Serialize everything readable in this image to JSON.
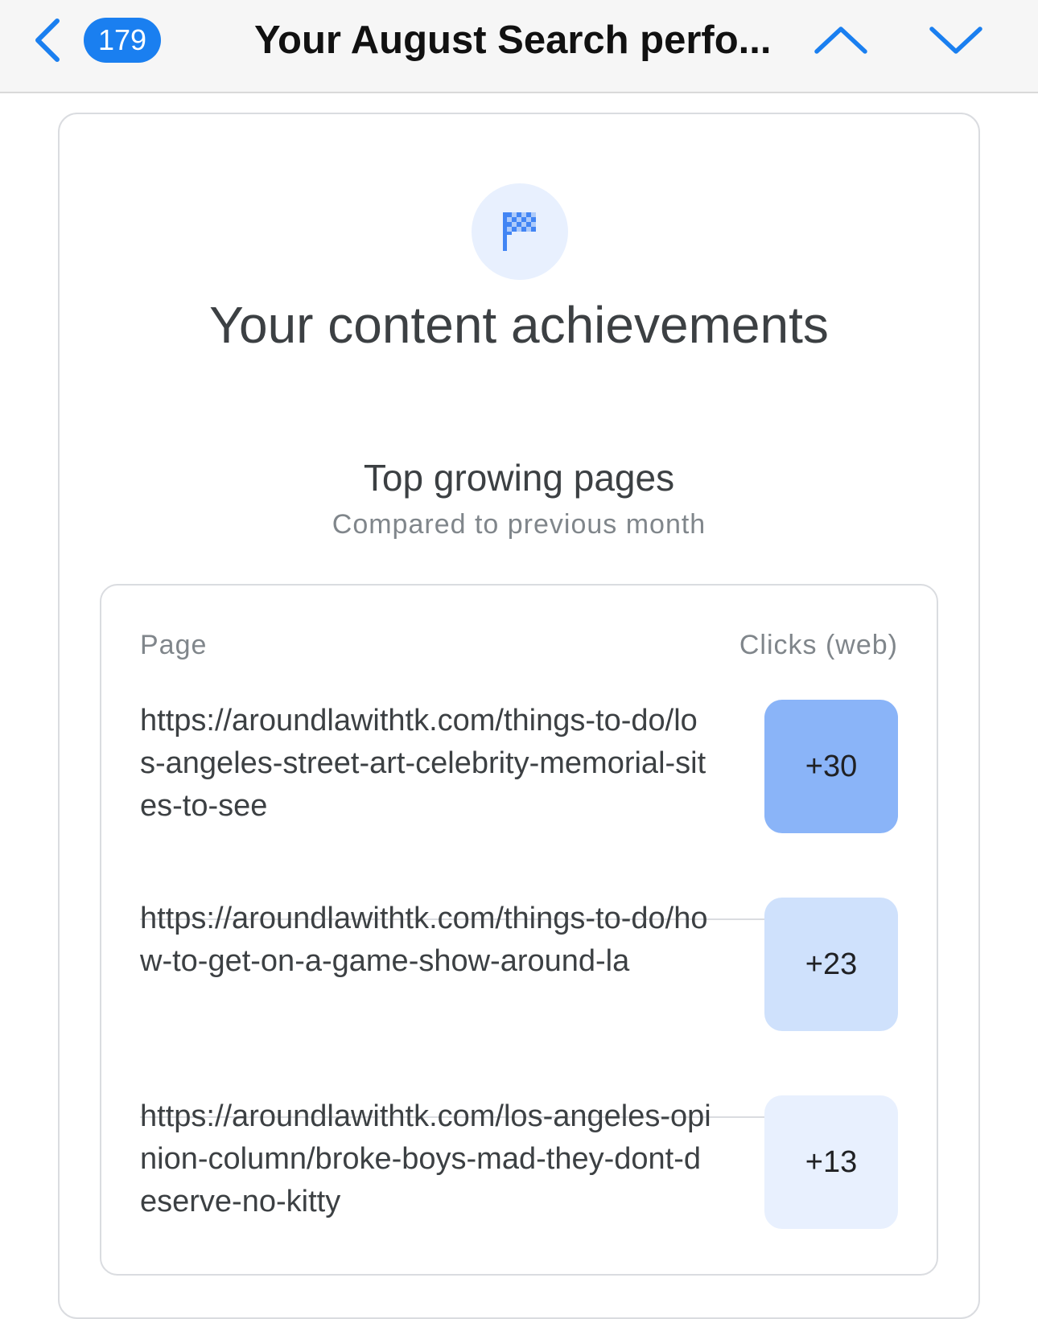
{
  "navbar": {
    "unread_count": "179",
    "title": "Your August Search perfo...",
    "accent_color": "#1a7ff0",
    "icons": {
      "back": "chevron-left-icon",
      "previous": "chevron-up-icon",
      "next": "chevron-down-icon"
    }
  },
  "card": {
    "icon": "checkered-flag-icon",
    "title": "Your content achievements",
    "section_title": "Top growing pages",
    "section_subtitle": "Compared to previous month"
  },
  "table": {
    "headers": {
      "page": "Page",
      "clicks": "Clicks (web)"
    },
    "rows": [
      {
        "url": "https://aroundlawithtk.com/things-to-do/los-angeles-street-art-celebrity-memorial-sites-to-see",
        "clicks": "+30",
        "color": "#8ab4f8"
      },
      {
        "url": "https://aroundlawithtk.com/things-to-do/how-to-get-on-a-game-show-around-la",
        "clicks": "+23",
        "color": "#cfe1fc"
      },
      {
        "url": "https://aroundlawithtk.com/los-angeles-opinion-column/broke-boys-mad-they-dont-deserve-no-kitty",
        "clicks": "+13",
        "color": "#e8f0fe"
      }
    ]
  }
}
